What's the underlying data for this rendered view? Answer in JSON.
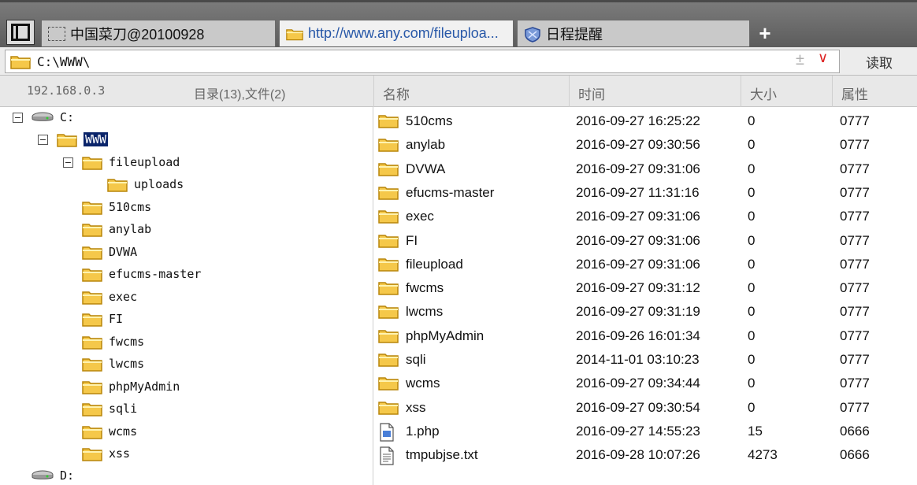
{
  "tabs": [
    {
      "label": "中国菜刀@20100928",
      "icon": "blank-page-icon",
      "active": false
    },
    {
      "label": "http://www.any.com/fileuploa...",
      "icon": "folder-icon",
      "active": true
    },
    {
      "label": "日程提醒",
      "icon": "shield-icon",
      "active": false
    }
  ],
  "tab_add_label": "+",
  "address": {
    "path": "C:\\WWW\\",
    "plus": "±",
    "dropdown": "∨",
    "read_label": "读取"
  },
  "header": {
    "ip": "192.168.0.3",
    "count": "目录(13),文件(2)",
    "col_name": "名称",
    "col_time": "时间",
    "col_size": "大小",
    "col_attr": "属性"
  },
  "tree": {
    "drive_c": "C:",
    "www": "WWW",
    "fileupload": "fileupload",
    "uploads": "uploads",
    "folders": [
      "510cms",
      "anylab",
      "DVWA",
      "efucms-master",
      "exec",
      "FI",
      "fwcms",
      "lwcms",
      "phpMyAdmin",
      "sqli",
      "wcms",
      "xss"
    ],
    "drive_d": "D:",
    "collapse_symbol": "−"
  },
  "files": [
    {
      "name": "510cms",
      "time": "2016-09-27 16:25:22",
      "size": "0",
      "attr": "0777",
      "type": "folder"
    },
    {
      "name": "anylab",
      "time": "2016-09-27 09:30:56",
      "size": "0",
      "attr": "0777",
      "type": "folder"
    },
    {
      "name": "DVWA",
      "time": "2016-09-27 09:31:06",
      "size": "0",
      "attr": "0777",
      "type": "folder"
    },
    {
      "name": "efucms-master",
      "time": "2016-09-27 11:31:16",
      "size": "0",
      "attr": "0777",
      "type": "folder"
    },
    {
      "name": "exec",
      "time": "2016-09-27 09:31:06",
      "size": "0",
      "attr": "0777",
      "type": "folder"
    },
    {
      "name": "FI",
      "time": "2016-09-27 09:31:06",
      "size": "0",
      "attr": "0777",
      "type": "folder"
    },
    {
      "name": "fileupload",
      "time": "2016-09-27 09:31:06",
      "size": "0",
      "attr": "0777",
      "type": "folder"
    },
    {
      "name": "fwcms",
      "time": "2016-09-27 09:31:12",
      "size": "0",
      "attr": "0777",
      "type": "folder"
    },
    {
      "name": "lwcms",
      "time": "2016-09-27 09:31:19",
      "size": "0",
      "attr": "0777",
      "type": "folder"
    },
    {
      "name": "phpMyAdmin",
      "time": "2016-09-26 16:01:34",
      "size": "0",
      "attr": "0777",
      "type": "folder"
    },
    {
      "name": "sqli",
      "time": "2014-11-01 03:10:23",
      "size": "0",
      "attr": "0777",
      "type": "folder"
    },
    {
      "name": "wcms",
      "time": "2016-09-27 09:34:44",
      "size": "0",
      "attr": "0777",
      "type": "folder"
    },
    {
      "name": "xss",
      "time": "2016-09-27 09:30:54",
      "size": "0",
      "attr": "0777",
      "type": "folder"
    },
    {
      "name": "1.php",
      "time": "2016-09-27 14:55:23",
      "size": "15",
      "attr": "0666",
      "type": "php-file"
    },
    {
      "name": "tmpubjse.txt",
      "time": "2016-09-28 10:07:26",
      "size": "4273",
      "attr": "0666",
      "type": "text-file"
    }
  ],
  "colors": {
    "selection": "#0a246a",
    "folder_fill": "#f5c84a",
    "folder_edge": "#b8860b",
    "active_tab_text": "#2858a8"
  }
}
